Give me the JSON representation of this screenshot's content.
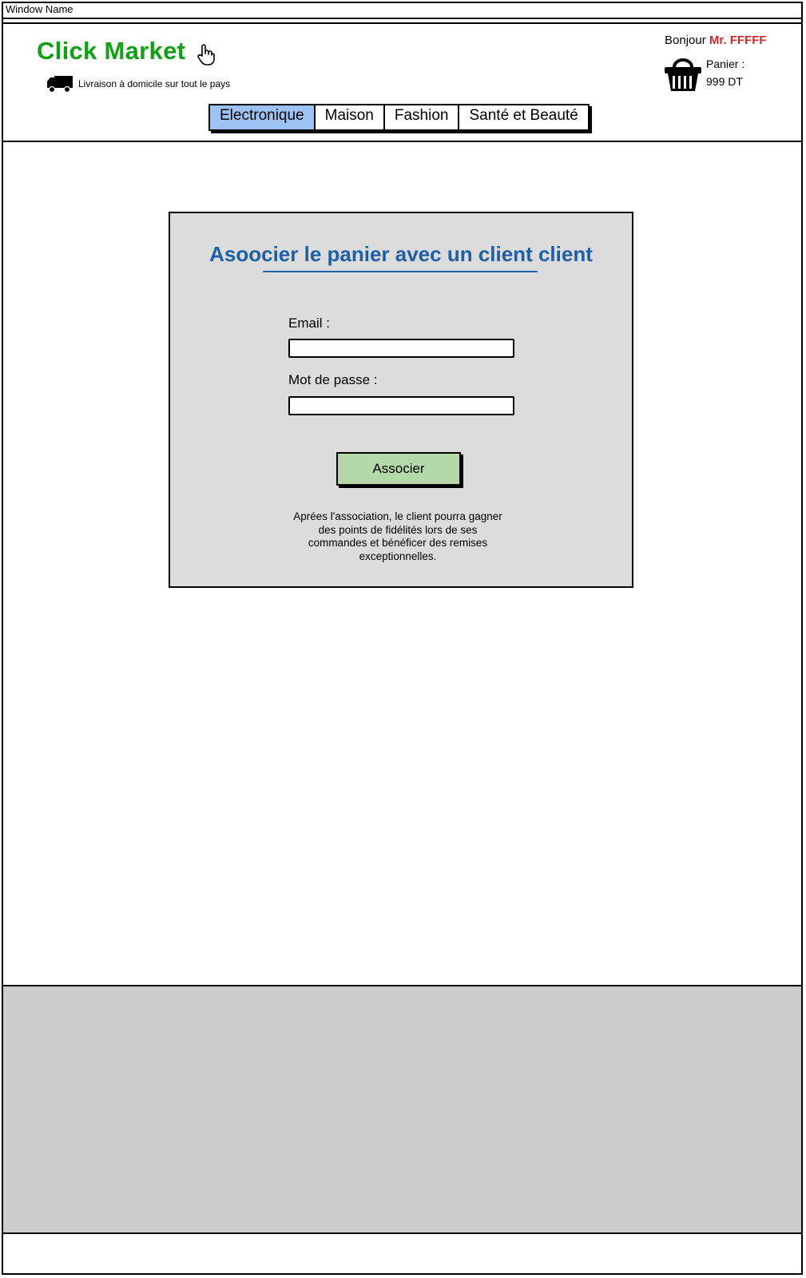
{
  "window": {
    "title": "Window Name"
  },
  "header": {
    "logo": "Click Market",
    "delivery": "Livraison à domicile sur tout le pays",
    "greeting": "Bonjour",
    "user_name": "Mr. FFFFF",
    "cart_label": "Panier :",
    "cart_total": "999 DT",
    "icons": [
      "hand-pointer-icon",
      "truck-icon",
      "basket-icon"
    ]
  },
  "nav": {
    "active": "Electronique",
    "tabs": [
      "Electronique",
      "Maison",
      "Fashion",
      "Santé et Beauté"
    ]
  },
  "form": {
    "title": "Asoocier le panier avec un client client",
    "email_label": "Email :",
    "email_value": "",
    "password_label": "Mot de passe :",
    "password_value": "",
    "submit_label": "Associer",
    "note": "Aprées l'association, le client pourra gagner des points de fidélités lors de ses commandes et bénéficer des remises exceptionnelles."
  },
  "colors": {
    "logo": "#12a014",
    "user_name": "#cc2a2a",
    "active_tab": "#9dc3f5",
    "title": "#1e5fa8",
    "panel_bg": "#dcdcdc",
    "button_bg": "#b4d8a8",
    "footer_bg": "#cccccc"
  }
}
